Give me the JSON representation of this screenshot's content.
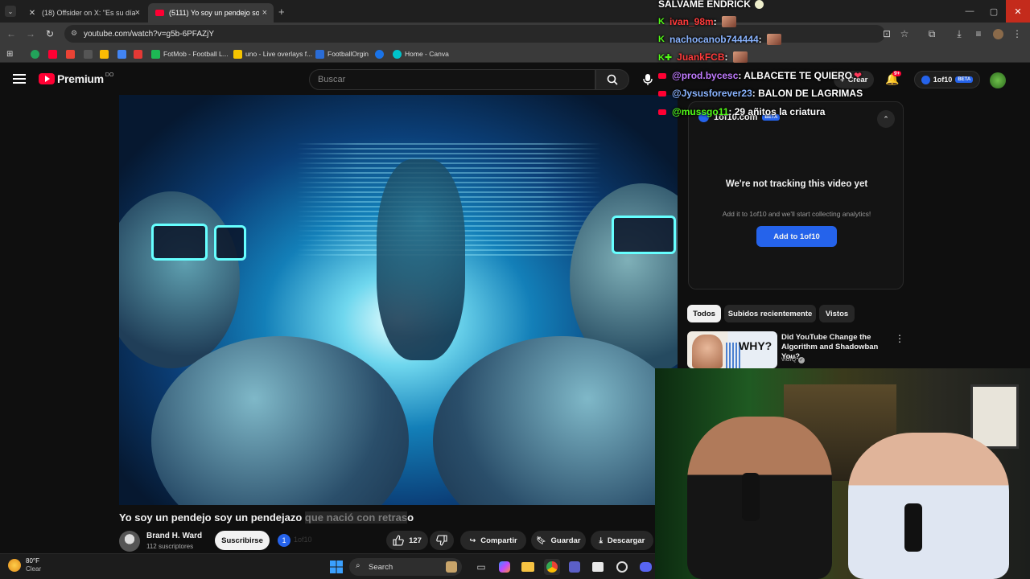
{
  "browser": {
    "tabs": [
      {
        "title": "(18) Offsider on X: \"Es su día. D",
        "icon": "x-logo-icon"
      },
      {
        "title": "(5111) Yo soy un pendejo soy u",
        "icon": "youtube-icon"
      }
    ],
    "url": "youtube.com/watch?v=g5b-6PFAZjY",
    "bookmarks": [
      {
        "label": "FotMob - Football L..."
      },
      {
        "label": "uno - Live overlays f..."
      },
      {
        "label": "FootballOrgin"
      },
      {
        "label": "Home - Canva"
      }
    ]
  },
  "youtube": {
    "logo_text": "Premium",
    "logo_sup": "DO",
    "search_placeholder": "Buscar",
    "create_label": "Crear",
    "notif_count": "9+",
    "oneof10_label": "1of10",
    "beta": "BETA"
  },
  "video": {
    "title_main": "Yo soy un pendejo soy un pendejazo ",
    "title_highlight": "que nació con retras",
    "title_end": "o",
    "channel_name": "Brand H. Ward",
    "channel_subs": "112 suscriptores",
    "subscribe_label": "Suscribirse",
    "oneof10_small": "1of10",
    "likes": "127",
    "share_label": "Compartir",
    "save_label": "Guardar",
    "download_label": "Descargar"
  },
  "panel": {
    "title": "1of10.com",
    "badge": "BETA",
    "message": "We're not tracking this video yet",
    "sub_message": "Add it to 1of10 and we'll start collecting analytics!",
    "button": "Add to 1of10"
  },
  "chips": [
    "Todos",
    "Subidos recientemente",
    "Vistos"
  ],
  "recommendation": {
    "title": "Did YouTube Change the Algorithm and Shadowban You?",
    "channel": "vidIQ",
    "thumb_text": "WHY?"
  },
  "chat": [
    {
      "user": "SALVAME ENDRICK",
      "text": "",
      "platform": "none",
      "color": "#ffffff"
    },
    {
      "user": "ivan_98m",
      "text": " :",
      "platform": "kick",
      "color": "#ff3b3b"
    },
    {
      "user": "nachocanob744444",
      "text": " :",
      "platform": "kick",
      "color": "#8ab4ff"
    },
    {
      "user": "JuankFCB",
      "text": " :",
      "platform": "kick",
      "color": "#ff3b3b"
    },
    {
      "user": "@prod.bycesc",
      "text": " : ALBACETE TE QUIERO",
      "platform": "youtube",
      "color": "#c07bff"
    },
    {
      "user": "@Jysusforever23",
      "text": " : BALON DE LAGRIMAS",
      "platform": "youtube",
      "color": "#8ab4ff"
    },
    {
      "user": "@mussgo11",
      "text": " : 29 añitos la criatura",
      "platform": "youtube",
      "color": "#53fc18"
    }
  ],
  "taskbar": {
    "weather_temp": "80°F",
    "weather_desc": "Clear",
    "search_label": "Search"
  },
  "colors": {
    "youtube_red": "#ff0033",
    "accent_blue": "#2563eb",
    "kick_green": "#53fc18"
  }
}
